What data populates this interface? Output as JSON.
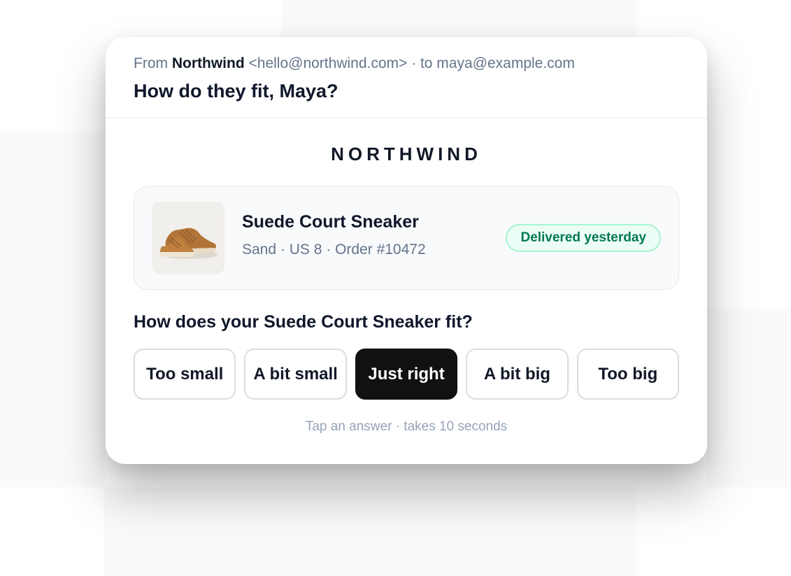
{
  "email": {
    "from_prefix": "From",
    "sender_name": "Northwind",
    "sender_address": "<hello@northwind.com>",
    "recipient_text": "· to maya@example.com",
    "subject": "How do they fit, Maya?"
  },
  "brand": {
    "wordmark": "NORTHWIND"
  },
  "product": {
    "name": "Suede Court Sneaker",
    "meta": "Sand · US 8 · Order #10472",
    "status_badge": "Delivered yesterday",
    "image_icon": "sneaker-image"
  },
  "survey": {
    "question": "How does your Suede Court Sneaker fit?",
    "options": [
      "Too small",
      "A bit small",
      "Just right",
      "A bit big",
      "Too big"
    ],
    "selected": "Just right",
    "hint": "Tap an answer · takes 10 seconds"
  },
  "colors": {
    "selected_option": "#111111",
    "badge_text": "#047857",
    "badge_background": "#ecfdf5",
    "muted_text": "#64748b"
  }
}
